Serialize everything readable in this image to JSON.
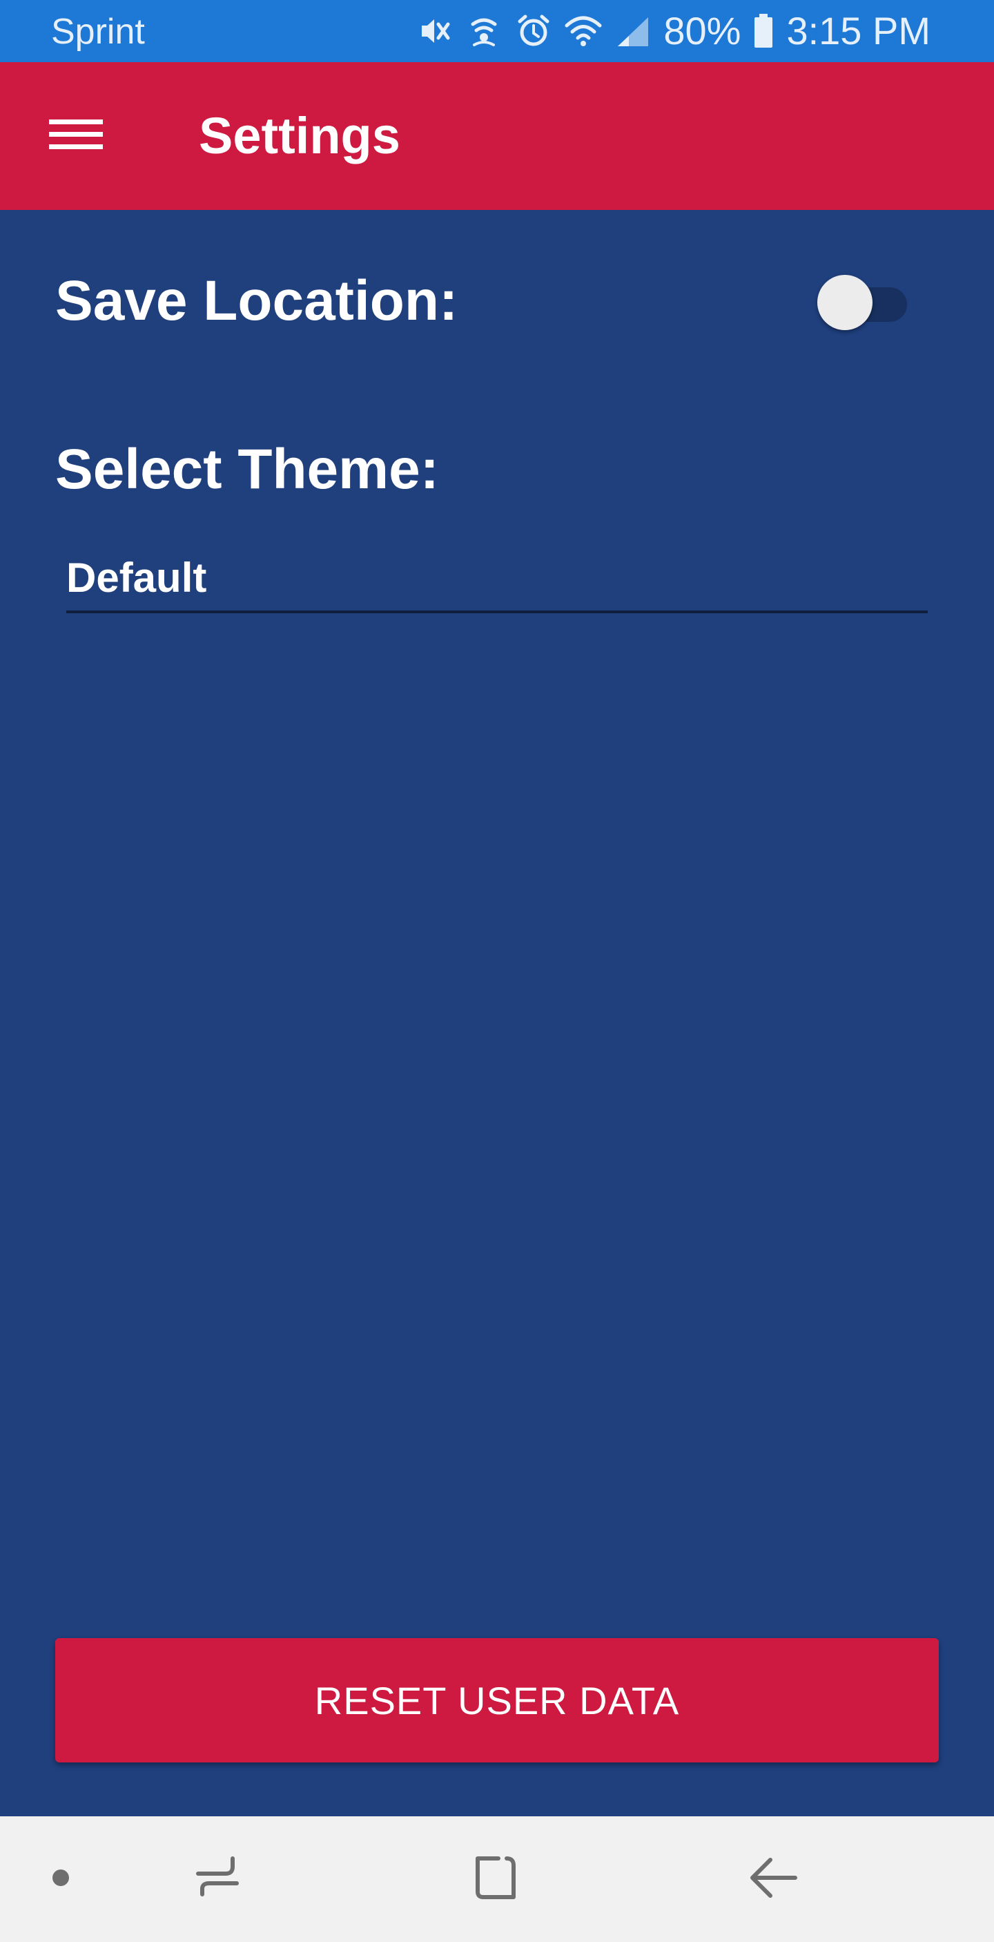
{
  "status_bar": {
    "carrier": "Sprint",
    "battery": "80%",
    "time": "3:15 PM",
    "icons": [
      "mute-icon",
      "nfc-icon",
      "alarm-icon",
      "wifi-icon",
      "signal-icon",
      "battery-icon"
    ],
    "color": "#1E78D6"
  },
  "app_bar": {
    "title": "Settings",
    "menu_icon": "hamburger-menu-icon",
    "color": "#CE1940"
  },
  "settings": {
    "save_location": {
      "label": "Save Location:",
      "enabled": false
    },
    "theme": {
      "label": "Select Theme:",
      "selected": "Default"
    }
  },
  "reset_button": {
    "label": "RESET USER DATA",
    "color": "#CE1940"
  },
  "nav_bar": {
    "items": [
      "dot-icon",
      "recent-apps-icon",
      "home-icon",
      "back-icon"
    ]
  },
  "colors": {
    "background": "#1F3F7D",
    "accent": "#CE1940",
    "status_bar": "#1E78D6"
  }
}
